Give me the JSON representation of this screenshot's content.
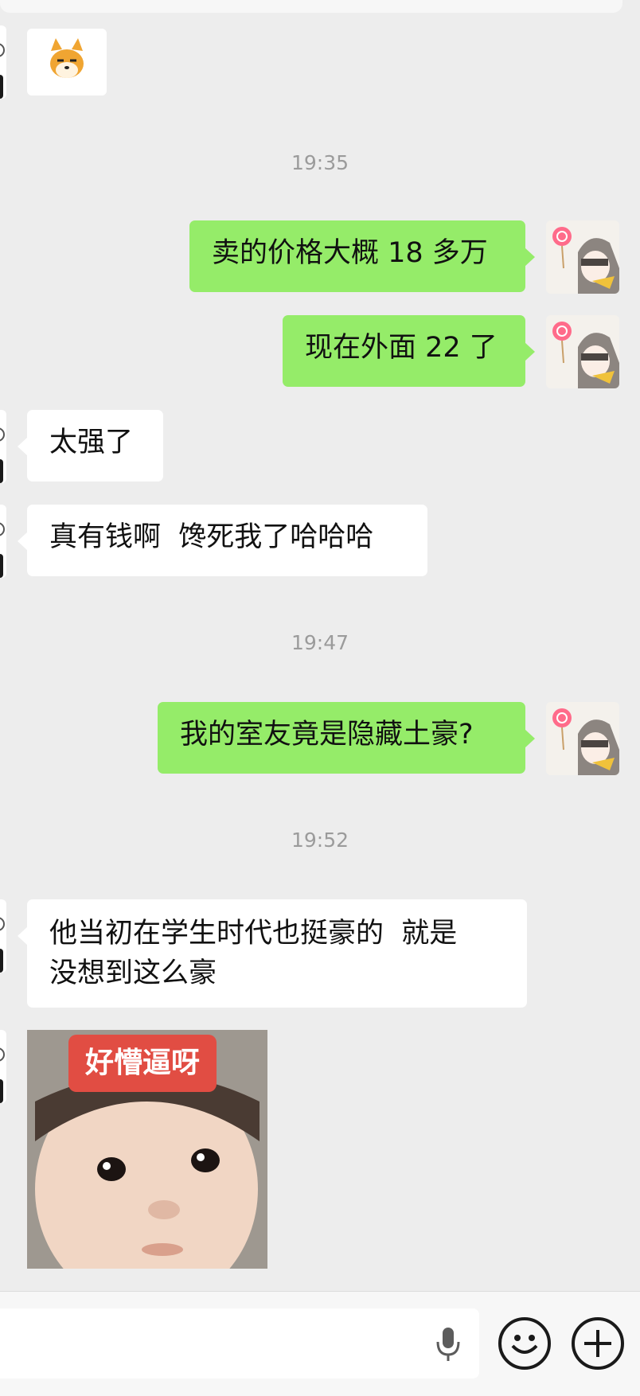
{
  "messages": [
    {
      "type": "sticker",
      "side": "left",
      "icon": "shiba-dog-sticker"
    },
    {
      "type": "time",
      "text": "19:35"
    },
    {
      "type": "text",
      "side": "right",
      "text": "卖的价格大概 18 多万"
    },
    {
      "type": "text",
      "side": "right",
      "text": "现在外面 22 了"
    },
    {
      "type": "text",
      "side": "left",
      "text": "太强了"
    },
    {
      "type": "text",
      "side": "left",
      "text": "真有钱啊  馋死我了哈哈哈"
    },
    {
      "type": "time",
      "text": "19:47"
    },
    {
      "type": "text",
      "side": "right",
      "text": "我的室友竟是隐藏土豪?"
    },
    {
      "type": "time",
      "text": "19:52"
    },
    {
      "type": "text",
      "side": "left",
      "lines": [
        "他当初在学生时代也挺豪的  就是",
        "没想到这么豪"
      ]
    },
    {
      "type": "image",
      "side": "left",
      "caption": "好懵逼呀",
      "icon": "baby-face-meme"
    }
  ],
  "input_bar": {
    "input_value": "",
    "icons": [
      "microphone-icon",
      "emoji-icon",
      "add-icon"
    ]
  },
  "colors": {
    "background": "#ededed",
    "sent_bubble": "#95ec69",
    "received_bubble": "#ffffff",
    "timestamp": "#9b9b9b",
    "meme_label": "#e14d43"
  }
}
